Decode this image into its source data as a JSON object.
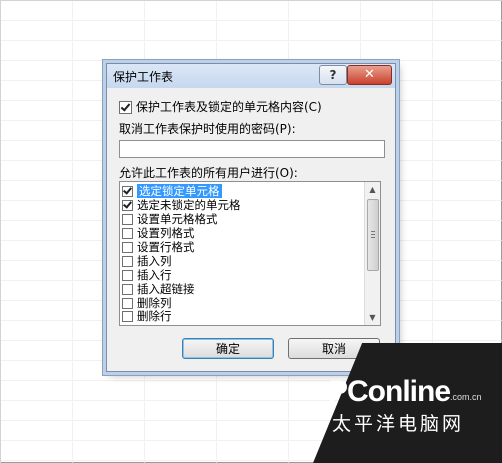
{
  "dialog": {
    "title": "保护工作表",
    "help_label": "?",
    "close_label": "✕",
    "protect_checkbox_label": "保护工作表及锁定的单元格内容(C)",
    "protect_checked": true,
    "password_label": "取消工作表保护时使用的密码(P):",
    "password_value": "",
    "allow_label": "允许此工作表的所有用户进行(O):",
    "permissions": [
      {
        "label": "选定锁定单元格",
        "checked": true,
        "selected": true
      },
      {
        "label": "选定未锁定的单元格",
        "checked": true,
        "selected": false
      },
      {
        "label": "设置单元格格式",
        "checked": false,
        "selected": false
      },
      {
        "label": "设置列格式",
        "checked": false,
        "selected": false
      },
      {
        "label": "设置行格式",
        "checked": false,
        "selected": false
      },
      {
        "label": "插入列",
        "checked": false,
        "selected": false
      },
      {
        "label": "插入行",
        "checked": false,
        "selected": false
      },
      {
        "label": "插入超链接",
        "checked": false,
        "selected": false
      },
      {
        "label": "删除列",
        "checked": false,
        "selected": false
      },
      {
        "label": "删除行",
        "checked": false,
        "selected": false
      }
    ],
    "ok_label": "确定",
    "cancel_label": "取消"
  },
  "watermark": {
    "logo": "PConline",
    "domain": ".com.cn",
    "subtitle": "太平洋电脑网"
  }
}
